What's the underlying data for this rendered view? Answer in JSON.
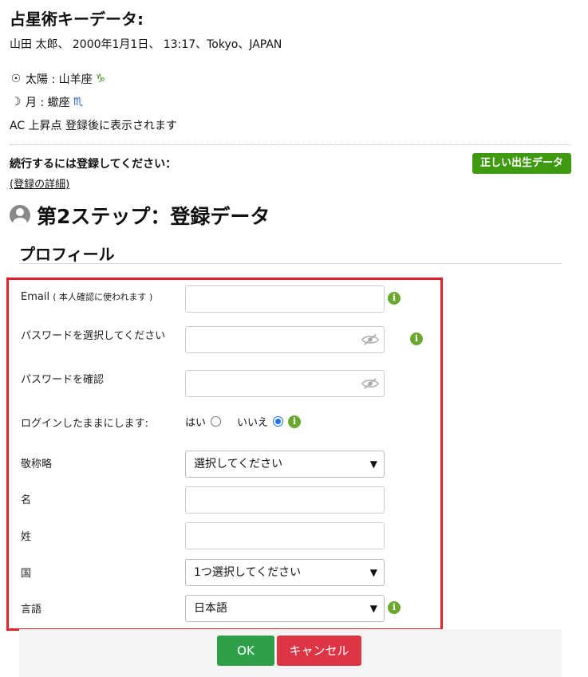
{
  "header": {
    "title": "占星術キーデータ:",
    "birth_info": "山田 太郎、 2000年1月1日、 13:17、Tokyo、JAPAN"
  },
  "planets": [
    {
      "symbol": "☉",
      "text": "太陽 : 山羊座",
      "sign_glyph": "♑",
      "sign_color": "#3a9a1a"
    },
    {
      "symbol": "☽",
      "text": "月 : 蠍座",
      "sign_glyph": "♏",
      "sign_color": "#1f5fd6"
    }
  ],
  "ascendant": "AC 上昇点 登録後に表示されます",
  "register": {
    "message": "続行するには登録してください：",
    "details_link": "(登録の詳細)",
    "correct_birth_button": "正しい出生データ"
  },
  "step": {
    "title": "第2ステップ：登録データ"
  },
  "profile": {
    "heading": "プロフィール",
    "email_label": "Email",
    "email_note": "( 本人確認に使われます )",
    "password_label": "パスワードを選択してください",
    "password_confirm_label": "パスワードを確認",
    "stay_logged_in_label": "ログインしたままにします:",
    "yes_label": "はい",
    "no_label": "いいえ",
    "stay_logged_in_value": "no",
    "honorific_label": "敬称略",
    "honorific_value": "選択してください",
    "first_name_label": "名",
    "last_name_label": "姓",
    "country_label": "国",
    "country_value": "1つ選択してください",
    "language_label": "言語",
    "language_value": "日本語"
  },
  "footer": {
    "ok_label": "OK",
    "cancel_label": "キャンセル"
  },
  "colors": {
    "accent_green": "#3f9a12",
    "ok_green": "#2ea04a",
    "cancel_red": "#dc3545",
    "highlight_red": "#e0232b",
    "info_green": "#6aa832"
  }
}
